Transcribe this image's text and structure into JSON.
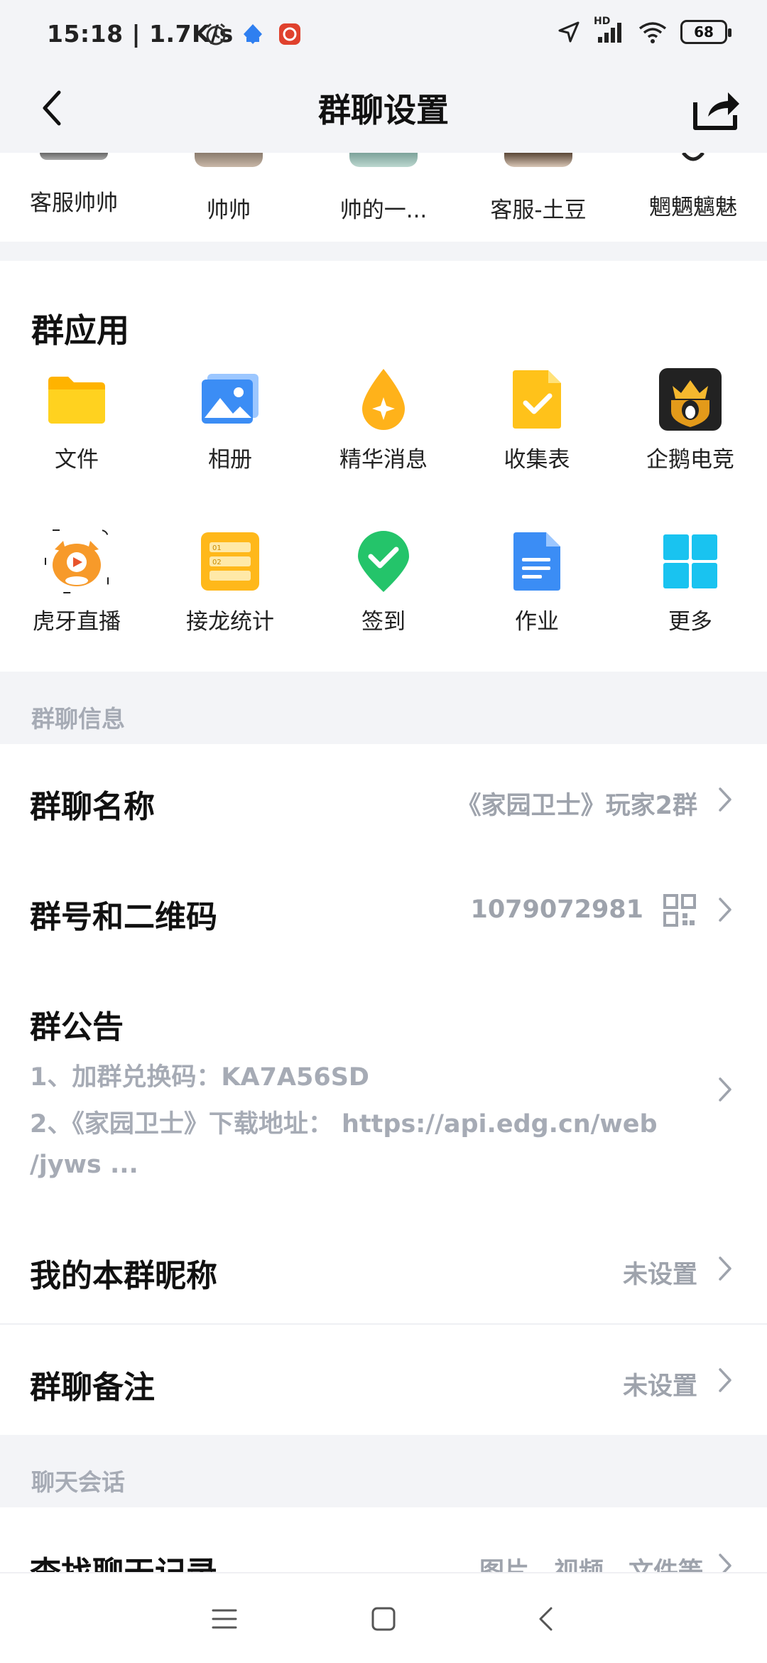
{
  "status_bar": {
    "time": "15:18 | 1.7K/s",
    "battery": "68",
    "hd_label": "HD"
  },
  "header": {
    "title": "群聊设置"
  },
  "members": [
    {
      "name": "客服帅帅"
    },
    {
      "name": "帅帅"
    },
    {
      "name": "帅的一..."
    },
    {
      "name": "客服-土豆"
    },
    {
      "name": "魍魉魑魅"
    }
  ],
  "group_apps": {
    "title": "群应用",
    "items": [
      {
        "label": "文件",
        "icon": "folder-icon"
      },
      {
        "label": "相册",
        "icon": "photo-album-icon"
      },
      {
        "label": "精华消息",
        "icon": "highlight-drop-icon"
      },
      {
        "label": "收集表",
        "icon": "form-check-icon"
      },
      {
        "label": "企鹅电竞",
        "icon": "penguin-esports-icon"
      },
      {
        "label": "虎牙直播",
        "icon": "huya-tiger-icon"
      },
      {
        "label": "接龙统计",
        "icon": "list-stats-icon"
      },
      {
        "label": "签到",
        "icon": "checkin-pin-icon"
      },
      {
        "label": "作业",
        "icon": "homework-doc-icon"
      },
      {
        "label": "更多",
        "icon": "more-grid-icon"
      }
    ]
  },
  "group_info": {
    "section_label": "群聊信息",
    "name": {
      "label": "群聊名称",
      "value": "《家园卫士》玩家2群"
    },
    "number": {
      "label": "群号和二维码",
      "value": "1079072981"
    },
    "notice": {
      "label": "群公告",
      "line1": "1、加群兑换码：KA7A56SD",
      "line2": "2、《家园卫士》下载地址：  https://api.edg.cn/web",
      "line3": "/jyws  ..."
    },
    "nickname": {
      "label": "我的本群昵称",
      "value": "未设置"
    },
    "remark": {
      "label": "群聊备注",
      "value": "未设置"
    }
  },
  "chat_session": {
    "section_label": "聊天会话",
    "search": {
      "label": "查找聊天记录",
      "value": "图片、视频、文件等"
    }
  },
  "colors": {
    "background_gray": "#f3f4f7",
    "secondary_text": "#9ea3ac",
    "accent_yellow": "#ffc21a",
    "accent_blue": "#3b8df5",
    "accent_green": "#24c46a"
  }
}
